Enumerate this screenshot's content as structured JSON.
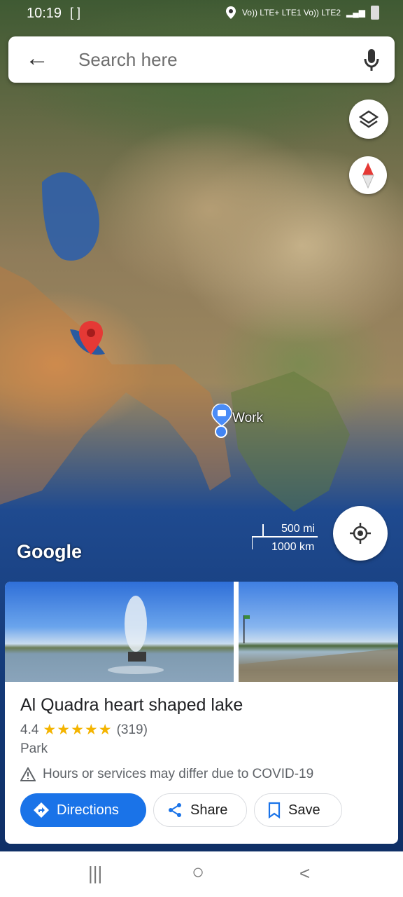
{
  "status_bar": {
    "time": "10:19",
    "signal_text": "Vo)) LTE+ LTE1 Vo)) LTE2"
  },
  "search": {
    "placeholder": "Search here"
  },
  "map": {
    "work_label": "Work",
    "scale_mi": "500 mi",
    "scale_km": "1000 km",
    "attribution": "Google"
  },
  "place_card": {
    "title": "Al Quadra heart shaped lake",
    "rating": "4.4",
    "stars": "★★★★★",
    "reviews": "(319)",
    "category": "Park",
    "notice": "Hours or services may differ due to COVID-19",
    "actions": {
      "directions": "Directions",
      "share": "Share",
      "save": "Save"
    }
  },
  "nav": {
    "recents": "|||",
    "home": "○",
    "back": "<"
  },
  "colors": {
    "accent": "#1a73e8",
    "star": "#f4b400",
    "pin": "#e53935"
  }
}
